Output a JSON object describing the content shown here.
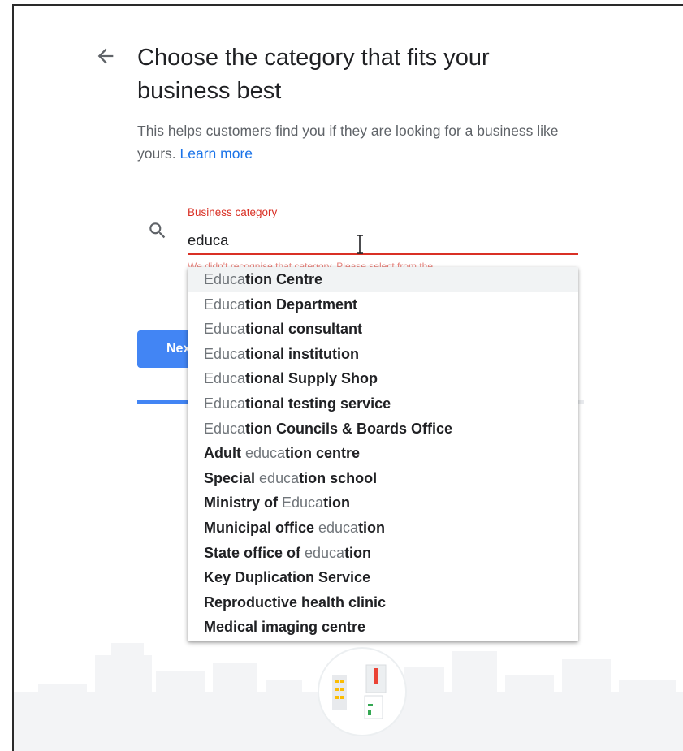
{
  "header": {
    "title": "Choose the category that fits your business best",
    "subtitle": "This helps customers find you if they are looking for a business like yours.",
    "learn_more": "Learn more"
  },
  "field": {
    "label": "Business category",
    "value": "educa",
    "error": "We didn't recognise that category. Please select from the"
  },
  "buttons": {
    "next": "Next"
  },
  "progress": {
    "fraction": 0.12
  },
  "dropdown": {
    "options": [
      {
        "parts": [
          {
            "t": "Educa",
            "m": true
          },
          {
            "t": "tion Centre",
            "m": false
          }
        ]
      },
      {
        "parts": [
          {
            "t": "Educa",
            "m": true
          },
          {
            "t": "tion Department",
            "m": false
          }
        ]
      },
      {
        "parts": [
          {
            "t": "Educa",
            "m": true
          },
          {
            "t": "tional consultant",
            "m": false
          }
        ]
      },
      {
        "parts": [
          {
            "t": "Educa",
            "m": true
          },
          {
            "t": "tional institution",
            "m": false
          }
        ]
      },
      {
        "parts": [
          {
            "t": "Educa",
            "m": true
          },
          {
            "t": "tional Supply Shop",
            "m": false
          }
        ]
      },
      {
        "parts": [
          {
            "t": "Educa",
            "m": true
          },
          {
            "t": "tional testing service",
            "m": false
          }
        ]
      },
      {
        "parts": [
          {
            "t": "Educa",
            "m": true
          },
          {
            "t": "tion Councils & Boards Office",
            "m": false
          }
        ]
      },
      {
        "parts": [
          {
            "t": "Adult ",
            "m": false
          },
          {
            "t": "educa",
            "m": true
          },
          {
            "t": "tion centre",
            "m": false
          }
        ]
      },
      {
        "parts": [
          {
            "t": "Special ",
            "m": false
          },
          {
            "t": "educa",
            "m": true
          },
          {
            "t": "tion school",
            "m": false
          }
        ]
      },
      {
        "parts": [
          {
            "t": "Ministry of ",
            "m": false
          },
          {
            "t": "Educa",
            "m": true
          },
          {
            "t": "tion",
            "m": false
          }
        ]
      },
      {
        "parts": [
          {
            "t": "Municipal office ",
            "m": false
          },
          {
            "t": "educa",
            "m": true
          },
          {
            "t": "tion",
            "m": false
          }
        ]
      },
      {
        "parts": [
          {
            "t": "State office of ",
            "m": false
          },
          {
            "t": "educa",
            "m": true
          },
          {
            "t": "tion",
            "m": false
          }
        ]
      },
      {
        "parts": [
          {
            "t": "Key Duplication Service",
            "m": false
          }
        ]
      },
      {
        "parts": [
          {
            "t": "Reproductive health clinic",
            "m": false
          }
        ]
      },
      {
        "parts": [
          {
            "t": "Medical imaging centre",
            "m": false
          }
        ]
      }
    ]
  },
  "icons": {
    "back": "arrow-back-icon",
    "search": "search-icon",
    "cursor": "text-cursor-icon",
    "illustration": "storefront-illustration-icon"
  },
  "colors": {
    "accent": "#4285f4",
    "link": "#1a73e8",
    "error": "#d93025",
    "text": "#202124",
    "muted": "#5f6368"
  }
}
